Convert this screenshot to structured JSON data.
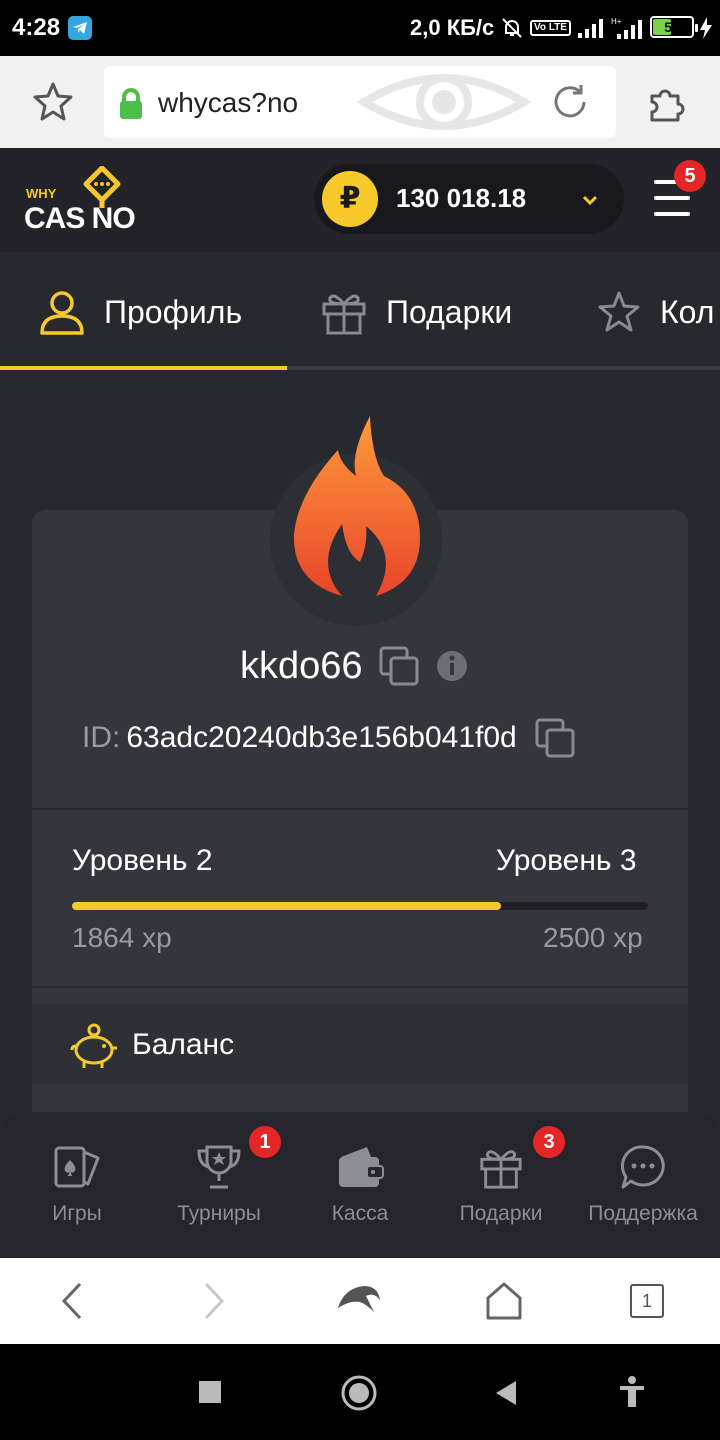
{
  "status_bar": {
    "time": "4:28",
    "net_speed": "2,0 КБ/с",
    "battery": "50",
    "lte_label": "Vo LTE",
    "accent": "#79d44a"
  },
  "browser": {
    "url": "whycas?no",
    "tab_count": "1"
  },
  "header": {
    "logo_top": "WHY",
    "logo_main": "CAS NO",
    "currency_symbol": "₽",
    "balance": "130 018.18",
    "menu_badge": "5",
    "accent": "#f7c92b"
  },
  "tabs": [
    {
      "label": "Профиль",
      "icon": "user-icon",
      "active": true
    },
    {
      "label": "Подарки",
      "icon": "gift-icon",
      "active": false
    },
    {
      "label": "Кол",
      "icon": "star-icon",
      "active": false
    }
  ],
  "profile": {
    "username": "kkdo66",
    "id_label": "ID:",
    "id_value": "63adc20240db3e156b041f0d",
    "level_current": "Уровень 2",
    "level_next": "Уровень 3",
    "xp_current": "1864 xp",
    "xp_next": "2500 xp",
    "progress_fraction": 0.7456
  },
  "balance_section": {
    "label": "Баланс"
  },
  "bottom_nav": [
    {
      "label": "Игры",
      "icon": "cards-icon",
      "badge": ""
    },
    {
      "label": "Турниры",
      "icon": "trophy-icon",
      "badge": "1"
    },
    {
      "label": "Касса",
      "icon": "wallet-icon",
      "badge": ""
    },
    {
      "label": "Подарки",
      "icon": "gift-icon",
      "badge": "3"
    },
    {
      "label": "Поддержка",
      "icon": "chat-icon",
      "badge": ""
    }
  ]
}
